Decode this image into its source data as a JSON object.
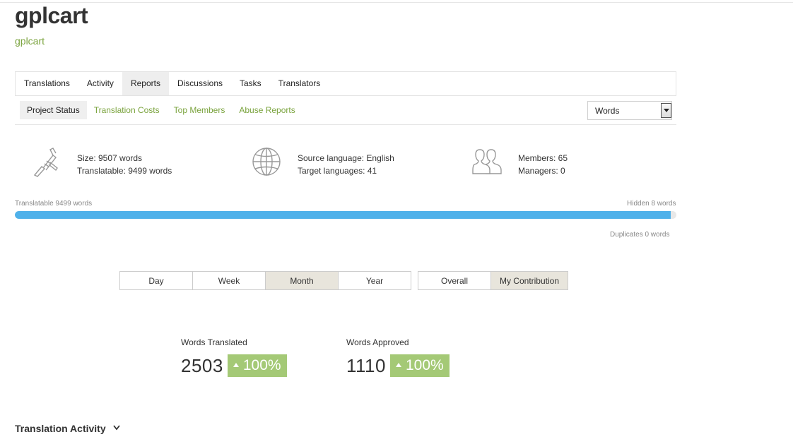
{
  "project": {
    "title": "gplcart",
    "subtitle": "gplcart"
  },
  "tabs": [
    {
      "label": "Translations"
    },
    {
      "label": "Activity"
    },
    {
      "label": "Reports",
      "active": true
    },
    {
      "label": "Discussions"
    },
    {
      "label": "Tasks"
    },
    {
      "label": "Translators"
    }
  ],
  "subtabs": [
    {
      "label": "Project Status",
      "active": true
    },
    {
      "label": "Translation Costs"
    },
    {
      "label": "Top Members"
    },
    {
      "label": "Abuse Reports"
    }
  ],
  "unit_select": {
    "value": "Words"
  },
  "stats": {
    "size": {
      "icon": "caliper-icon",
      "line1": "Size: 9507 words",
      "line2": "Translatable: 9499 words"
    },
    "languages": {
      "icon": "globe-icon",
      "line1": "Source language: English",
      "line2": "Target languages: 41"
    },
    "members": {
      "icon": "users-icon",
      "line1": "Members: 65",
      "line2": "Managers: 0"
    }
  },
  "progress": {
    "left_label": "Translatable 9499 words",
    "right_label": "Hidden 8 words",
    "fraction": 0.9916,
    "duplicates_label": "Duplicates 0 words",
    "fill_color": "#4fb1ea"
  },
  "period_buttons": [
    {
      "label": "Day"
    },
    {
      "label": "Week"
    },
    {
      "label": "Month",
      "active": true
    },
    {
      "label": "Year"
    }
  ],
  "scope_buttons": [
    {
      "label": "Overall"
    },
    {
      "label": "My Contribution",
      "active": true
    }
  ],
  "metrics": {
    "translated": {
      "label": "Words Translated",
      "value": "2503",
      "change": "100%"
    },
    "approved": {
      "label": "Words Approved",
      "value": "1110",
      "change": "100%"
    }
  },
  "badge_color": "#a4c976",
  "section": {
    "title": "Translation Activity"
  }
}
